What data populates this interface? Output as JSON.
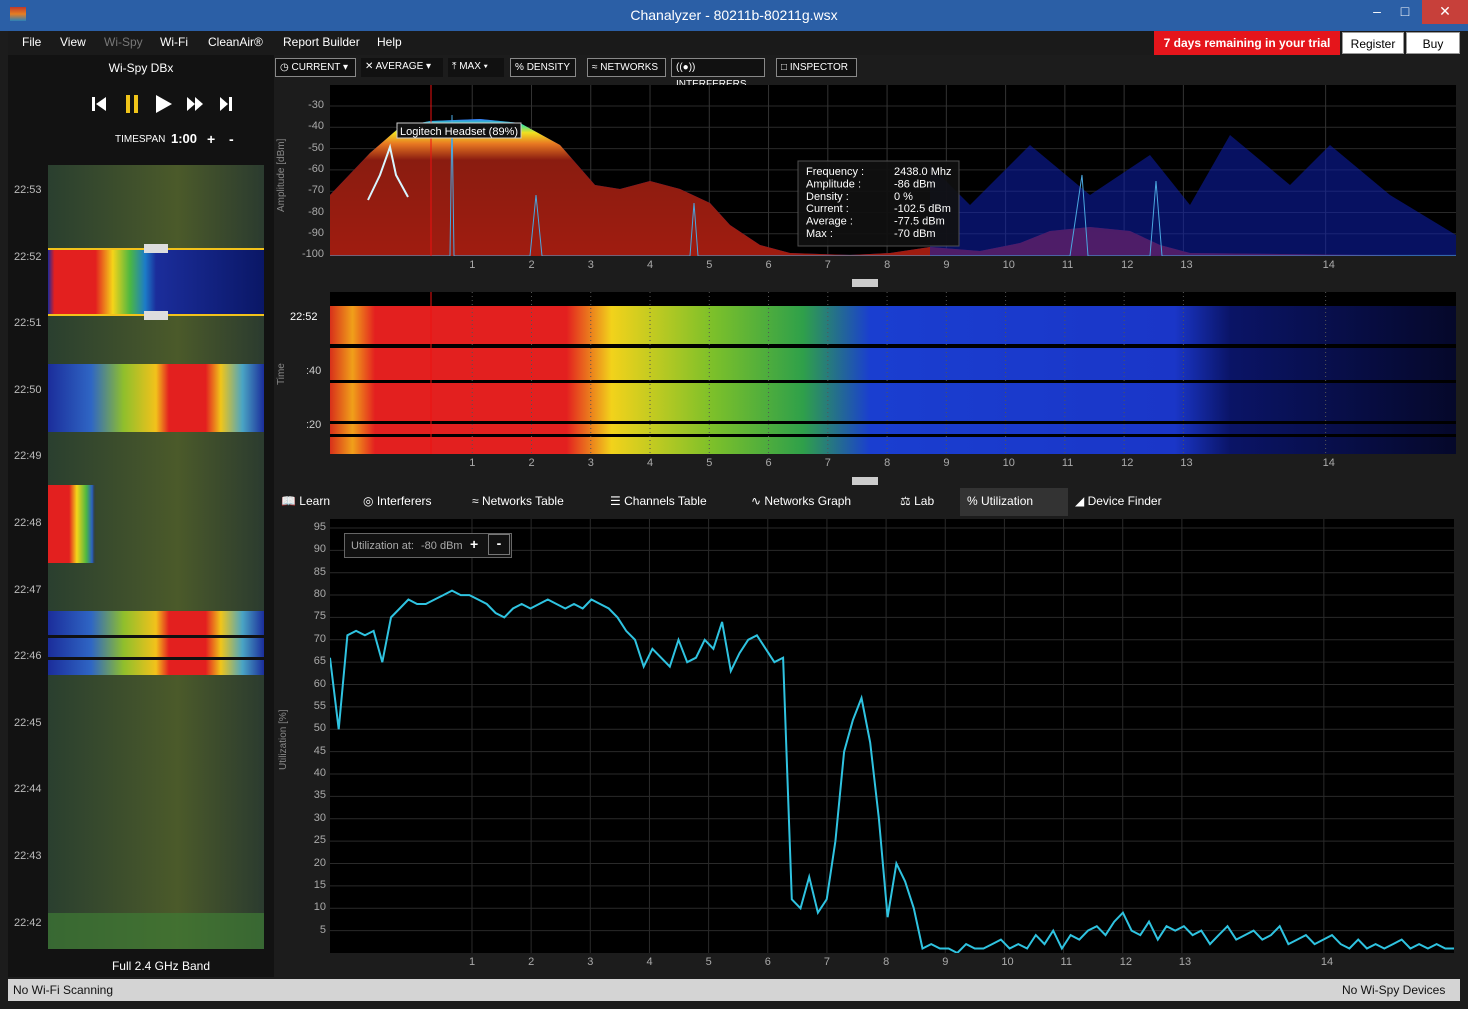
{
  "window": {
    "title": "Chanalyzer - 80211b-80211g.wsx"
  },
  "menu": [
    "File",
    "View",
    "Wi-Spy",
    "Wi-Fi",
    "CleanAir®",
    "Report Builder",
    "Help"
  ],
  "trial": {
    "text": "7 days remaining in your trial",
    "register": "Register",
    "buy": "Buy"
  },
  "device": {
    "name": "Wi-Spy DBx",
    "timespan_label": "TIMESPAN",
    "timespan_value": "1:00",
    "plus": "+",
    "minus": "-"
  },
  "left_times": [
    "22:53",
    "22:52",
    "22:51",
    "22:50",
    "22:49",
    "22:48",
    "22:47",
    "22:46",
    "22:45",
    "22:44",
    "22:43",
    "22:42"
  ],
  "band": "Full 2.4 GHz Band",
  "toolbar": {
    "current": "CURRENT",
    "average": "AVERAGE",
    "max": "MAX",
    "density": "DENSITY",
    "networks": "NETWORKS",
    "interferers": "INTERFERERS",
    "inspector": "INSPECTOR"
  },
  "spectrum": {
    "ylabel": "Amplitude [dBm]",
    "yticks": [
      "-30",
      "-40",
      "-50",
      "-60",
      "-70",
      "-80",
      "-90",
      "-100"
    ],
    "channels": [
      "1",
      "2",
      "3",
      "4",
      "5",
      "6",
      "7",
      "8",
      "9",
      "10",
      "11",
      "12",
      "13",
      "14"
    ],
    "tag": "Logitech Headset (89%)",
    "inspector": [
      {
        "k": "Frequency :",
        "v": "2438.0 Mhz"
      },
      {
        "k": "Amplitude :",
        "v": "-86 dBm"
      },
      {
        "k": "Density :",
        "v": "0 %"
      },
      {
        "k": "Current :",
        "v": "-102.5 dBm"
      },
      {
        "k": "Average :",
        "v": "-77.5 dBm"
      },
      {
        "k": "Max :",
        "v": "-70 dBm"
      }
    ]
  },
  "waterfall": {
    "ylabel": "Time",
    "times": [
      "22:52",
      ":40",
      ":20"
    ]
  },
  "tabs": [
    "Learn",
    "Interferers",
    "Networks Table",
    "Channels Table",
    "Networks Graph",
    "Lab",
    "Utilization",
    "Device Finder"
  ],
  "utilization": {
    "ylabel": "Utilization [%]",
    "label": "Utilization at:",
    "level": "-80 dBm",
    "plus": "+",
    "minus": "-",
    "yticks": [
      "95",
      "90",
      "85",
      "80",
      "75",
      "70",
      "65",
      "60",
      "55",
      "50",
      "45",
      "40",
      "35",
      "30",
      "25",
      "20",
      "15",
      "10",
      "5"
    ]
  },
  "status": {
    "left": "No Wi-Fi Scanning",
    "right": "No Wi-Spy Devices"
  },
  "chart_data": {
    "type": "line",
    "title": "",
    "xlabel": "",
    "ylabel": "Utilization [%]",
    "ylim": [
      0,
      97
    ],
    "categories": [
      "1",
      "2",
      "3",
      "4",
      "5",
      "6",
      "7",
      "8",
      "9",
      "10",
      "11",
      "12",
      "13",
      "14"
    ],
    "series": [
      {
        "values": [
          66,
          50,
          71,
          72,
          71,
          72,
          65,
          75,
          77,
          79,
          78,
          78,
          79,
          80,
          81,
          80,
          80,
          79,
          78,
          76,
          75,
          77,
          78,
          77,
          78,
          79,
          78,
          77,
          78,
          77,
          79,
          78,
          77,
          75,
          72,
          70,
          64,
          68,
          66,
          64,
          70,
          65,
          66,
          70,
          68,
          74,
          63,
          67,
          70,
          71,
          68,
          65,
          66,
          12,
          10,
          17,
          9,
          12,
          25,
          45,
          52,
          57,
          47,
          30,
          8,
          20,
          16,
          10,
          1,
          2,
          1,
          1,
          0,
          2,
          1,
          1,
          2,
          3,
          1,
          2,
          1,
          4,
          2,
          5,
          1,
          4,
          3,
          5,
          6,
          4,
          7,
          9,
          5,
          4,
          7,
          3,
          6,
          5,
          6,
          4,
          5,
          2,
          4,
          6,
          3,
          4,
          5,
          3,
          4,
          6,
          2,
          3,
          4,
          2,
          3,
          4,
          2,
          1,
          3,
          1,
          2,
          1,
          2,
          3,
          1,
          2,
          1,
          2,
          1,
          1
        ]
      }
    ]
  }
}
